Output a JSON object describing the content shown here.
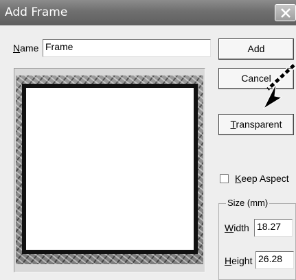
{
  "window": {
    "title": "Add Frame"
  },
  "name_field": {
    "label_mnemonic": "N",
    "label_rest": "ame",
    "value": "Frame"
  },
  "buttons": {
    "add": "Add",
    "cancel": "Cancel",
    "transparent_mnemonic": "T",
    "transparent_rest": "ransparent"
  },
  "keep_aspect": {
    "mnemonic": "K",
    "rest": "eep Aspect",
    "checked": false
  },
  "size": {
    "group_title": "Size (mm)",
    "width_mnemonic": "W",
    "width_rest": "idth",
    "width_value": "18.27",
    "height_mnemonic": "H",
    "height_rest": "eight",
    "height_value": "26.28"
  },
  "icons": {
    "close": "close-icon",
    "pointer": "arrow-pointer-icon"
  }
}
